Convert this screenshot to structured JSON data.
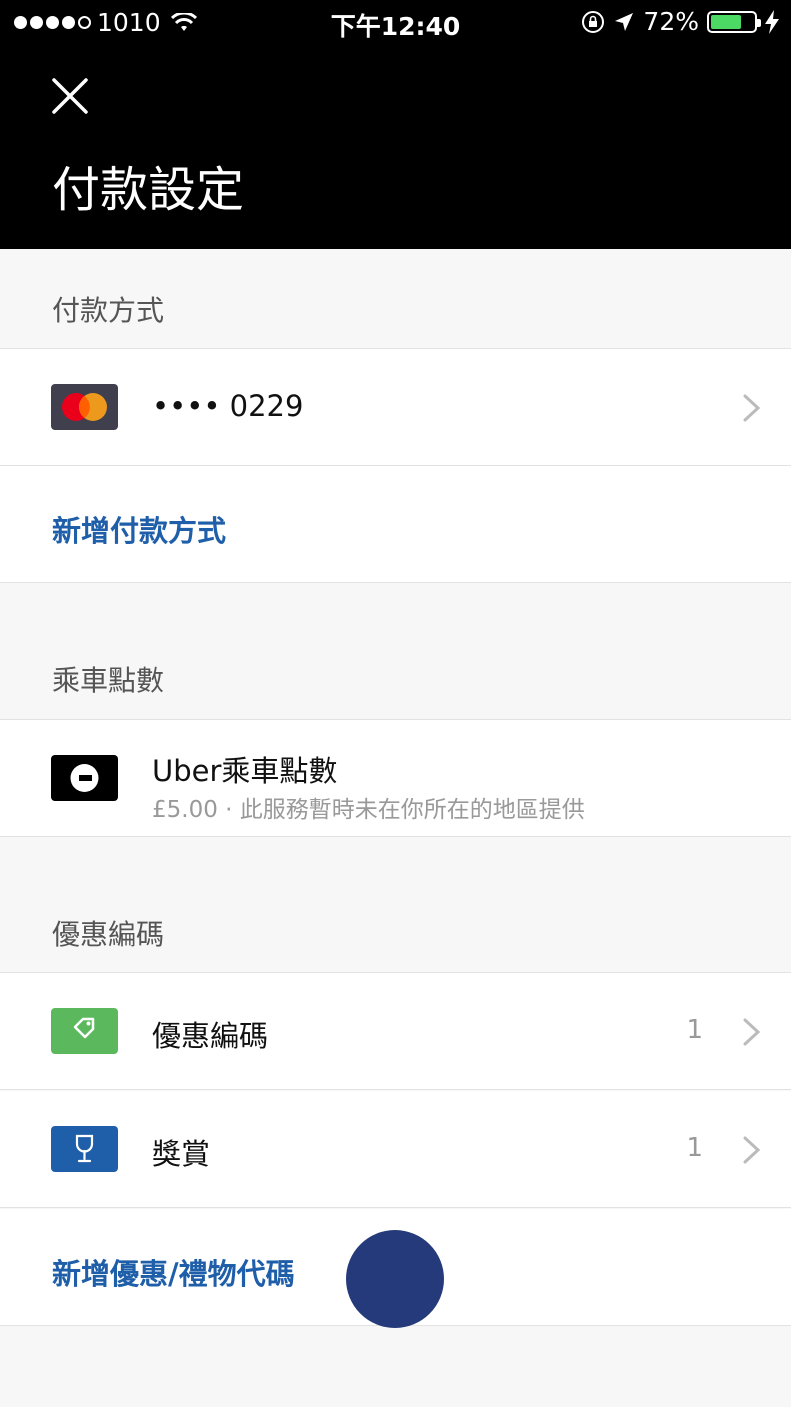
{
  "status_bar": {
    "carrier": "1010",
    "time": "下午12:40",
    "battery_percent": "72%",
    "battery_level": 0.72
  },
  "header": {
    "title": "付款設定",
    "close_icon": "close-icon"
  },
  "payment_methods": {
    "section_title": "付款方式",
    "card_label": "•••• 0229",
    "card_icon": "mastercard-icon",
    "add_label": "新增付款方式"
  },
  "ride_credits": {
    "section_title": "乘車點數",
    "label": "Uber乘車點數",
    "sublabel": "£5.00 · 此服務暫時未在你所在的地區提供",
    "icon": "uber-logo-icon"
  },
  "promotions": {
    "section_title": "優惠編碼",
    "promo_label": "優惠編碼",
    "promo_count": "1",
    "rewards_label": "獎賞",
    "rewards_count": "1",
    "add_label": "新增優惠/禮物代碼"
  },
  "colors": {
    "link": "#1f5fa9",
    "promo_icon_bg": "#5cb85c",
    "rewards_icon_bg": "#1f5fa9",
    "card_icon_bg": "#3f3f4d"
  }
}
